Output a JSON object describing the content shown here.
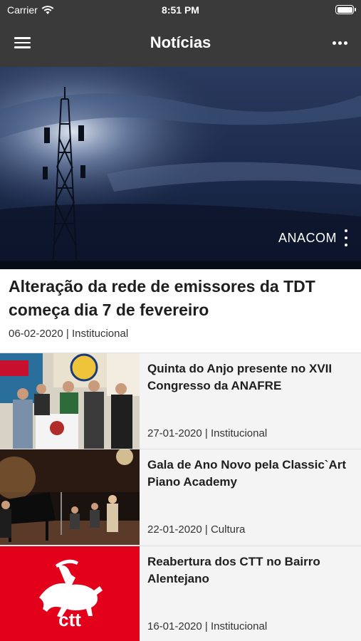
{
  "status_bar": {
    "carrier": "Carrier",
    "time": "8:51 PM"
  },
  "nav": {
    "title": "Notícias",
    "menu_icon": "hamburger-menu-icon",
    "more_icon": "more-horizontal-icon"
  },
  "featured": {
    "image_watermark": "ANACOM",
    "headline": "Alteração da rede de emissores da TDT começa dia 7 de fevereiro",
    "meta": "06-02-2020 | Institucional"
  },
  "news": [
    {
      "headline": "Quinta do Anjo presente no XVII Congresso da ANAFRE",
      "meta": "27-01-2020 | Institucional"
    },
    {
      "headline": "Gala de Ano Novo pela Classic`Art Piano Academy",
      "meta": "22-01-2020 | Cultura"
    },
    {
      "headline": "Reabertura dos CTT no Bairro Alentejano",
      "meta": "16-01-2020 | Institucional",
      "thumb_logo": "ctt"
    }
  ],
  "colors": {
    "navbar": "#3a3a3a",
    "ctt_red": "#e2001a",
    "background": "#f2f2f2"
  }
}
